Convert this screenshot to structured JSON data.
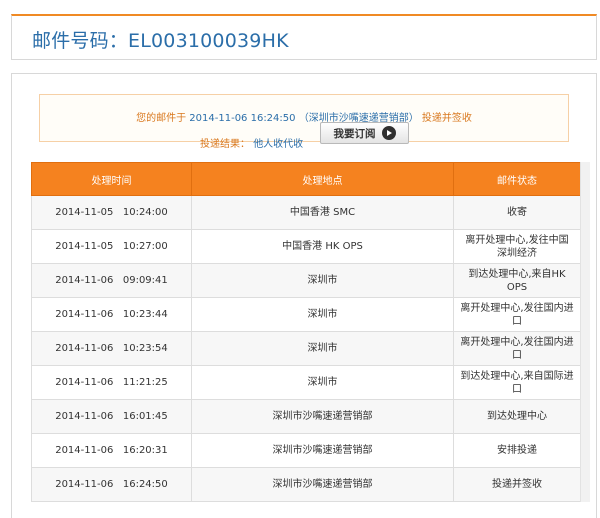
{
  "header": {
    "title": "邮件号码：EL003100039HK"
  },
  "notice": {
    "prefix": "您的邮件于",
    "datetime": "2014-11-06 16:24:50",
    "location": "（深圳市沙嘴速递营销部）",
    "action": "投递并签收",
    "result_label": "投递结果：",
    "result_value": "他人收代收",
    "subscribe_label": "我要订阅"
  },
  "table": {
    "headers": [
      "处理时间",
      "处理地点",
      "邮件状态"
    ],
    "rows": [
      {
        "time": "2014-11-05   10:24:00",
        "place": "中国香港 SMC",
        "status": "收寄"
      },
      {
        "time": "2014-11-05   10:27:00",
        "place": "中国香港 HK OPS",
        "status": "离开处理中心,发往中国 深圳经济"
      },
      {
        "time": "2014-11-06   09:09:41",
        "place": "深圳市",
        "status": "到达处理中心,来自HK OPS"
      },
      {
        "time": "2014-11-06   10:23:44",
        "place": "深圳市",
        "status": "离开处理中心,发往国内进口"
      },
      {
        "time": "2014-11-06   10:23:54",
        "place": "深圳市",
        "status": "离开处理中心,发往国内进口"
      },
      {
        "time": "2014-11-06   11:21:25",
        "place": "深圳市",
        "status": "到达处理中心,来自国际进口"
      },
      {
        "time": "2014-11-06   16:01:45",
        "place": "深圳市沙嘴速递营销部",
        "status": "到达处理中心"
      },
      {
        "time": "2014-11-06   16:20:31",
        "place": "深圳市沙嘴速递营销部",
        "status": "安排投递"
      },
      {
        "time": "2014-11-06   16:24:50",
        "place": "深圳市沙嘴速递营销部",
        "status": "投递并签收"
      }
    ]
  },
  "colors": {
    "accent": "#f5821f",
    "link": "#2b6ea9",
    "notice_text": "#d9781e"
  }
}
